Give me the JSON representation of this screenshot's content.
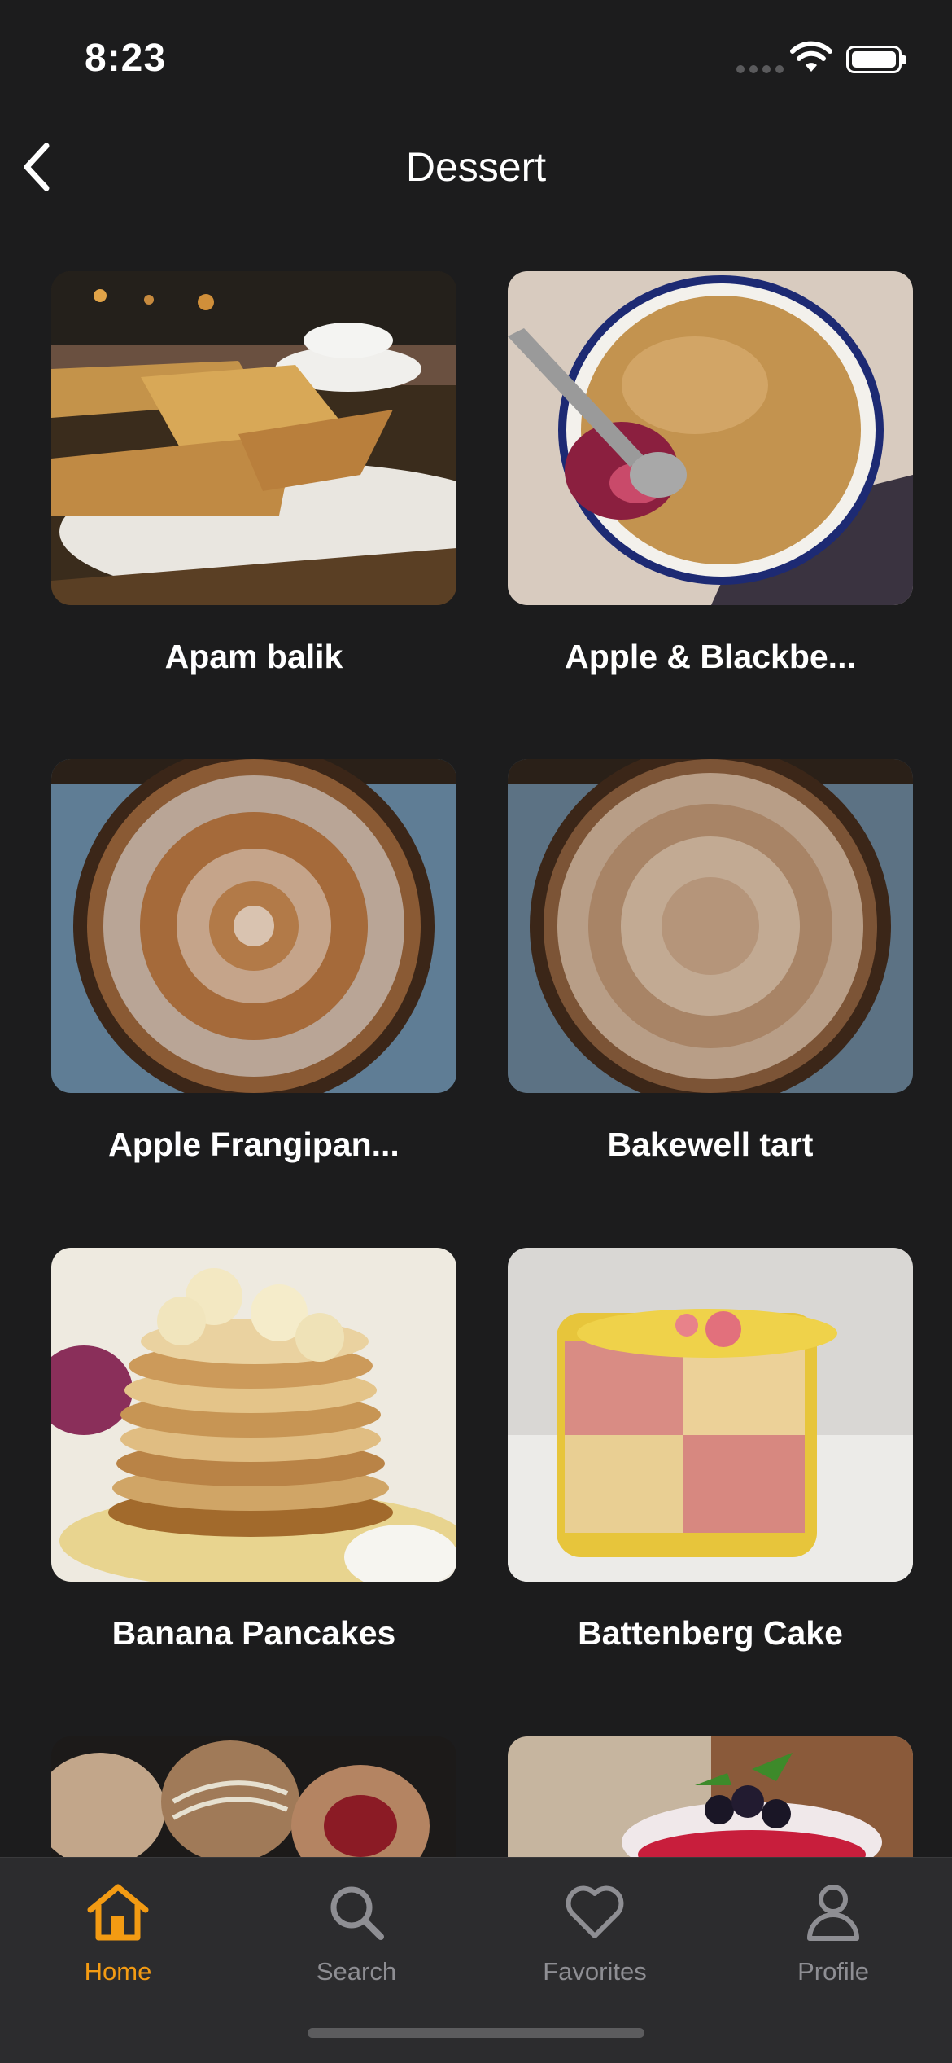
{
  "status_bar": {
    "time": "8:23"
  },
  "nav": {
    "title": "Dessert"
  },
  "recipes": [
    {
      "name": "Apam balik"
    },
    {
      "name": "Apple & Blackbe..."
    },
    {
      "name": "Apple Frangipan..."
    },
    {
      "name": "Bakewell tart"
    },
    {
      "name": "Banana Pancakes"
    },
    {
      "name": "Battenberg Cake"
    }
  ],
  "tabs": [
    {
      "label": "Home",
      "icon": "home-icon",
      "active": true
    },
    {
      "label": "Search",
      "icon": "search-icon",
      "active": false
    },
    {
      "label": "Favorites",
      "icon": "heart-icon",
      "active": false
    },
    {
      "label": "Profile",
      "icon": "person-icon",
      "active": false
    }
  ],
  "colors": {
    "accent": "#f39b13",
    "background": "#1c1c1d",
    "tabbar": "#2c2c2e",
    "inactive": "#8e8e93"
  }
}
